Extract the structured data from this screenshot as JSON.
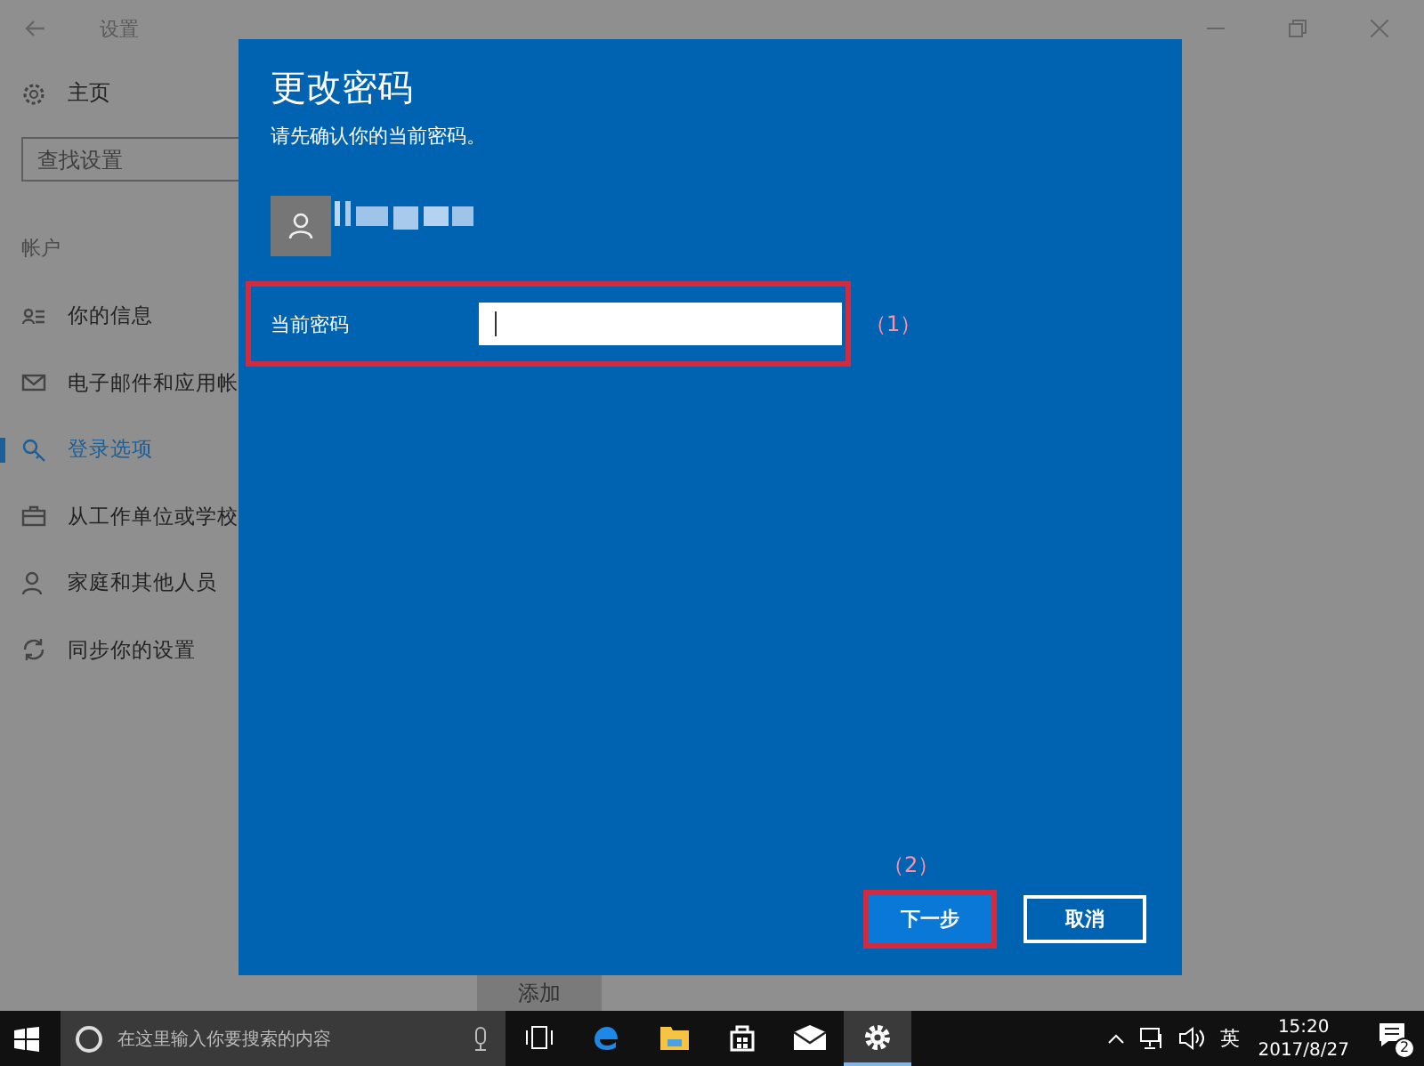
{
  "window": {
    "title": "设置"
  },
  "sidebar": {
    "home": "主页",
    "search": {
      "placeholder": "查找设置"
    },
    "section": "帐户",
    "items": [
      {
        "label": "你的信息",
        "kind": "person-list",
        "selected": false
      },
      {
        "label": "电子邮件和应用帐",
        "kind": "mail",
        "selected": false
      },
      {
        "label": "登录选项",
        "kind": "key",
        "selected": true
      },
      {
        "label": "从工作单位或学校",
        "kind": "briefcase",
        "selected": false
      },
      {
        "label": "家庭和其他人员",
        "kind": "person",
        "selected": false
      },
      {
        "label": "同步你的设置",
        "kind": "sync",
        "selected": false
      }
    ]
  },
  "behind": {
    "add_button": "添加"
  },
  "dialog": {
    "title": "更改密码",
    "subtitle": "请先确认你的当前密码。",
    "field": {
      "label": "当前密码",
      "focused": true
    },
    "annotations": [
      "（1）",
      "（2）"
    ],
    "buttons": [
      {
        "label": "下一步",
        "kind": "primary",
        "highlighted": true
      },
      {
        "label": "取消",
        "kind": "secondary",
        "highlighted": false
      }
    ]
  },
  "taskbar": {
    "search": {
      "placeholder": "在这里输入你要搜索的内容"
    },
    "apps": [
      {
        "kind": "task-view",
        "active": false
      },
      {
        "kind": "edge",
        "active": false
      },
      {
        "kind": "folder",
        "active": false
      },
      {
        "kind": "store",
        "active": false
      },
      {
        "kind": "mail",
        "active": false
      },
      {
        "kind": "settings",
        "active": true
      }
    ],
    "language": "英",
    "time": "15:20",
    "date": "2017/8/27",
    "notifications": "2"
  }
}
